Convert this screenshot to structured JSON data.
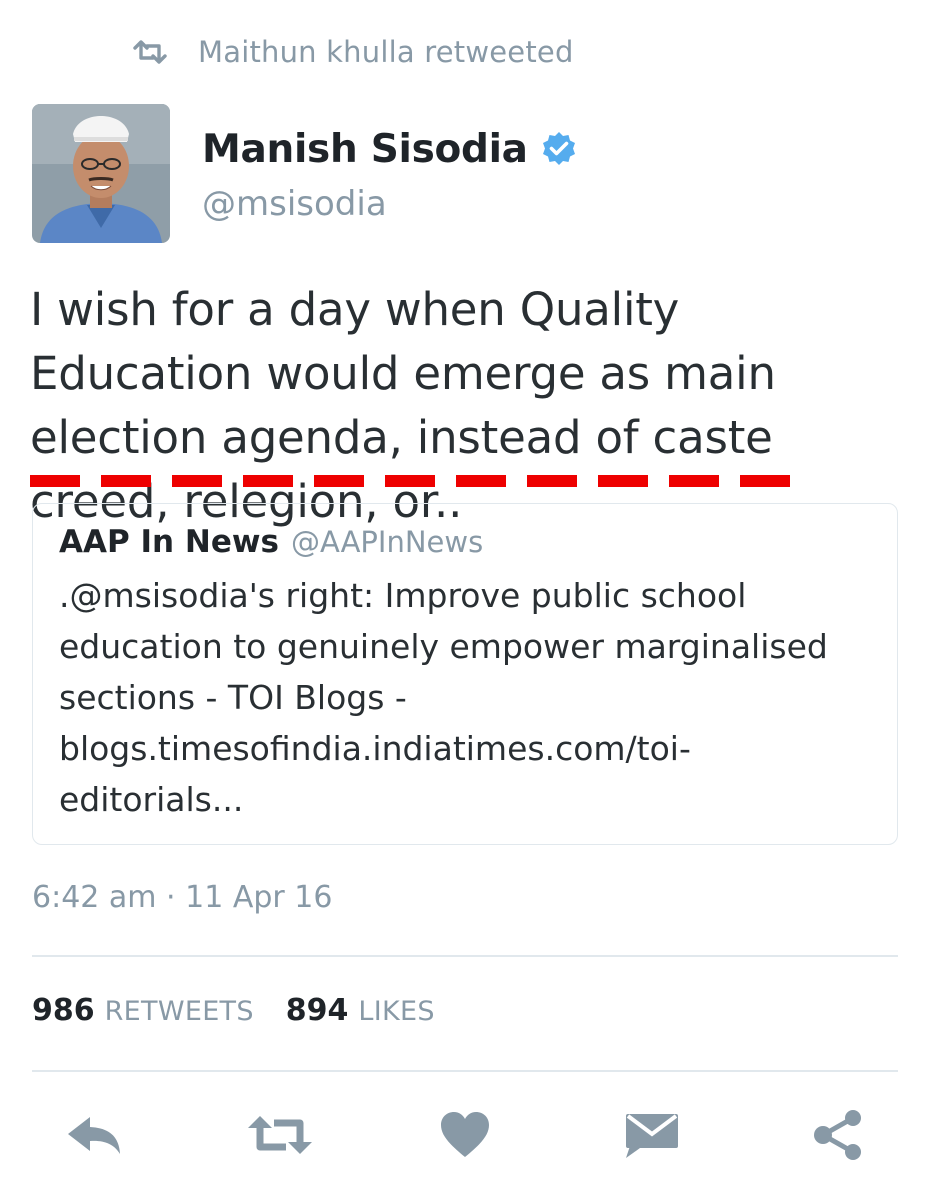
{
  "retweet_context": {
    "text": "Maithun khulla retweeted",
    "icon": "retweet-icon"
  },
  "tweet": {
    "author": {
      "display_name": "Manish Sisodia",
      "handle": "@msisodia",
      "verified": true,
      "avatar_icon": "avatar-photo"
    },
    "text": "I wish for a day when Quality Education would emerge as main election agenda, instead of caste creed, relegion, or..",
    "quoted": {
      "display_name": "AAP In News",
      "handle": "@AAPInNews",
      "text": ".@msisodia's right: Improve public school\neducation to genuinely empower marginalised\nsections - TOI Blogs -\nblogs.timesofindia.indiatimes.com/toi-\neditorials..."
    },
    "timestamp": "6:42 am · 11 Apr 16",
    "stats": {
      "retweets_count": "986",
      "retweets_label": "RETWEETS",
      "likes_count": "894",
      "likes_label": "LIKES"
    },
    "actions": [
      "reply-icon",
      "retweet-icon",
      "like-icon",
      "message-icon",
      "share-icon"
    ]
  },
  "colors": {
    "text_primary": "#292f33",
    "text_secondary": "#8899a6",
    "verified_badge": "#55acee",
    "annotation_red": "#ee0000",
    "divider": "#e1e8ed",
    "action_icon": "#8899a6"
  }
}
